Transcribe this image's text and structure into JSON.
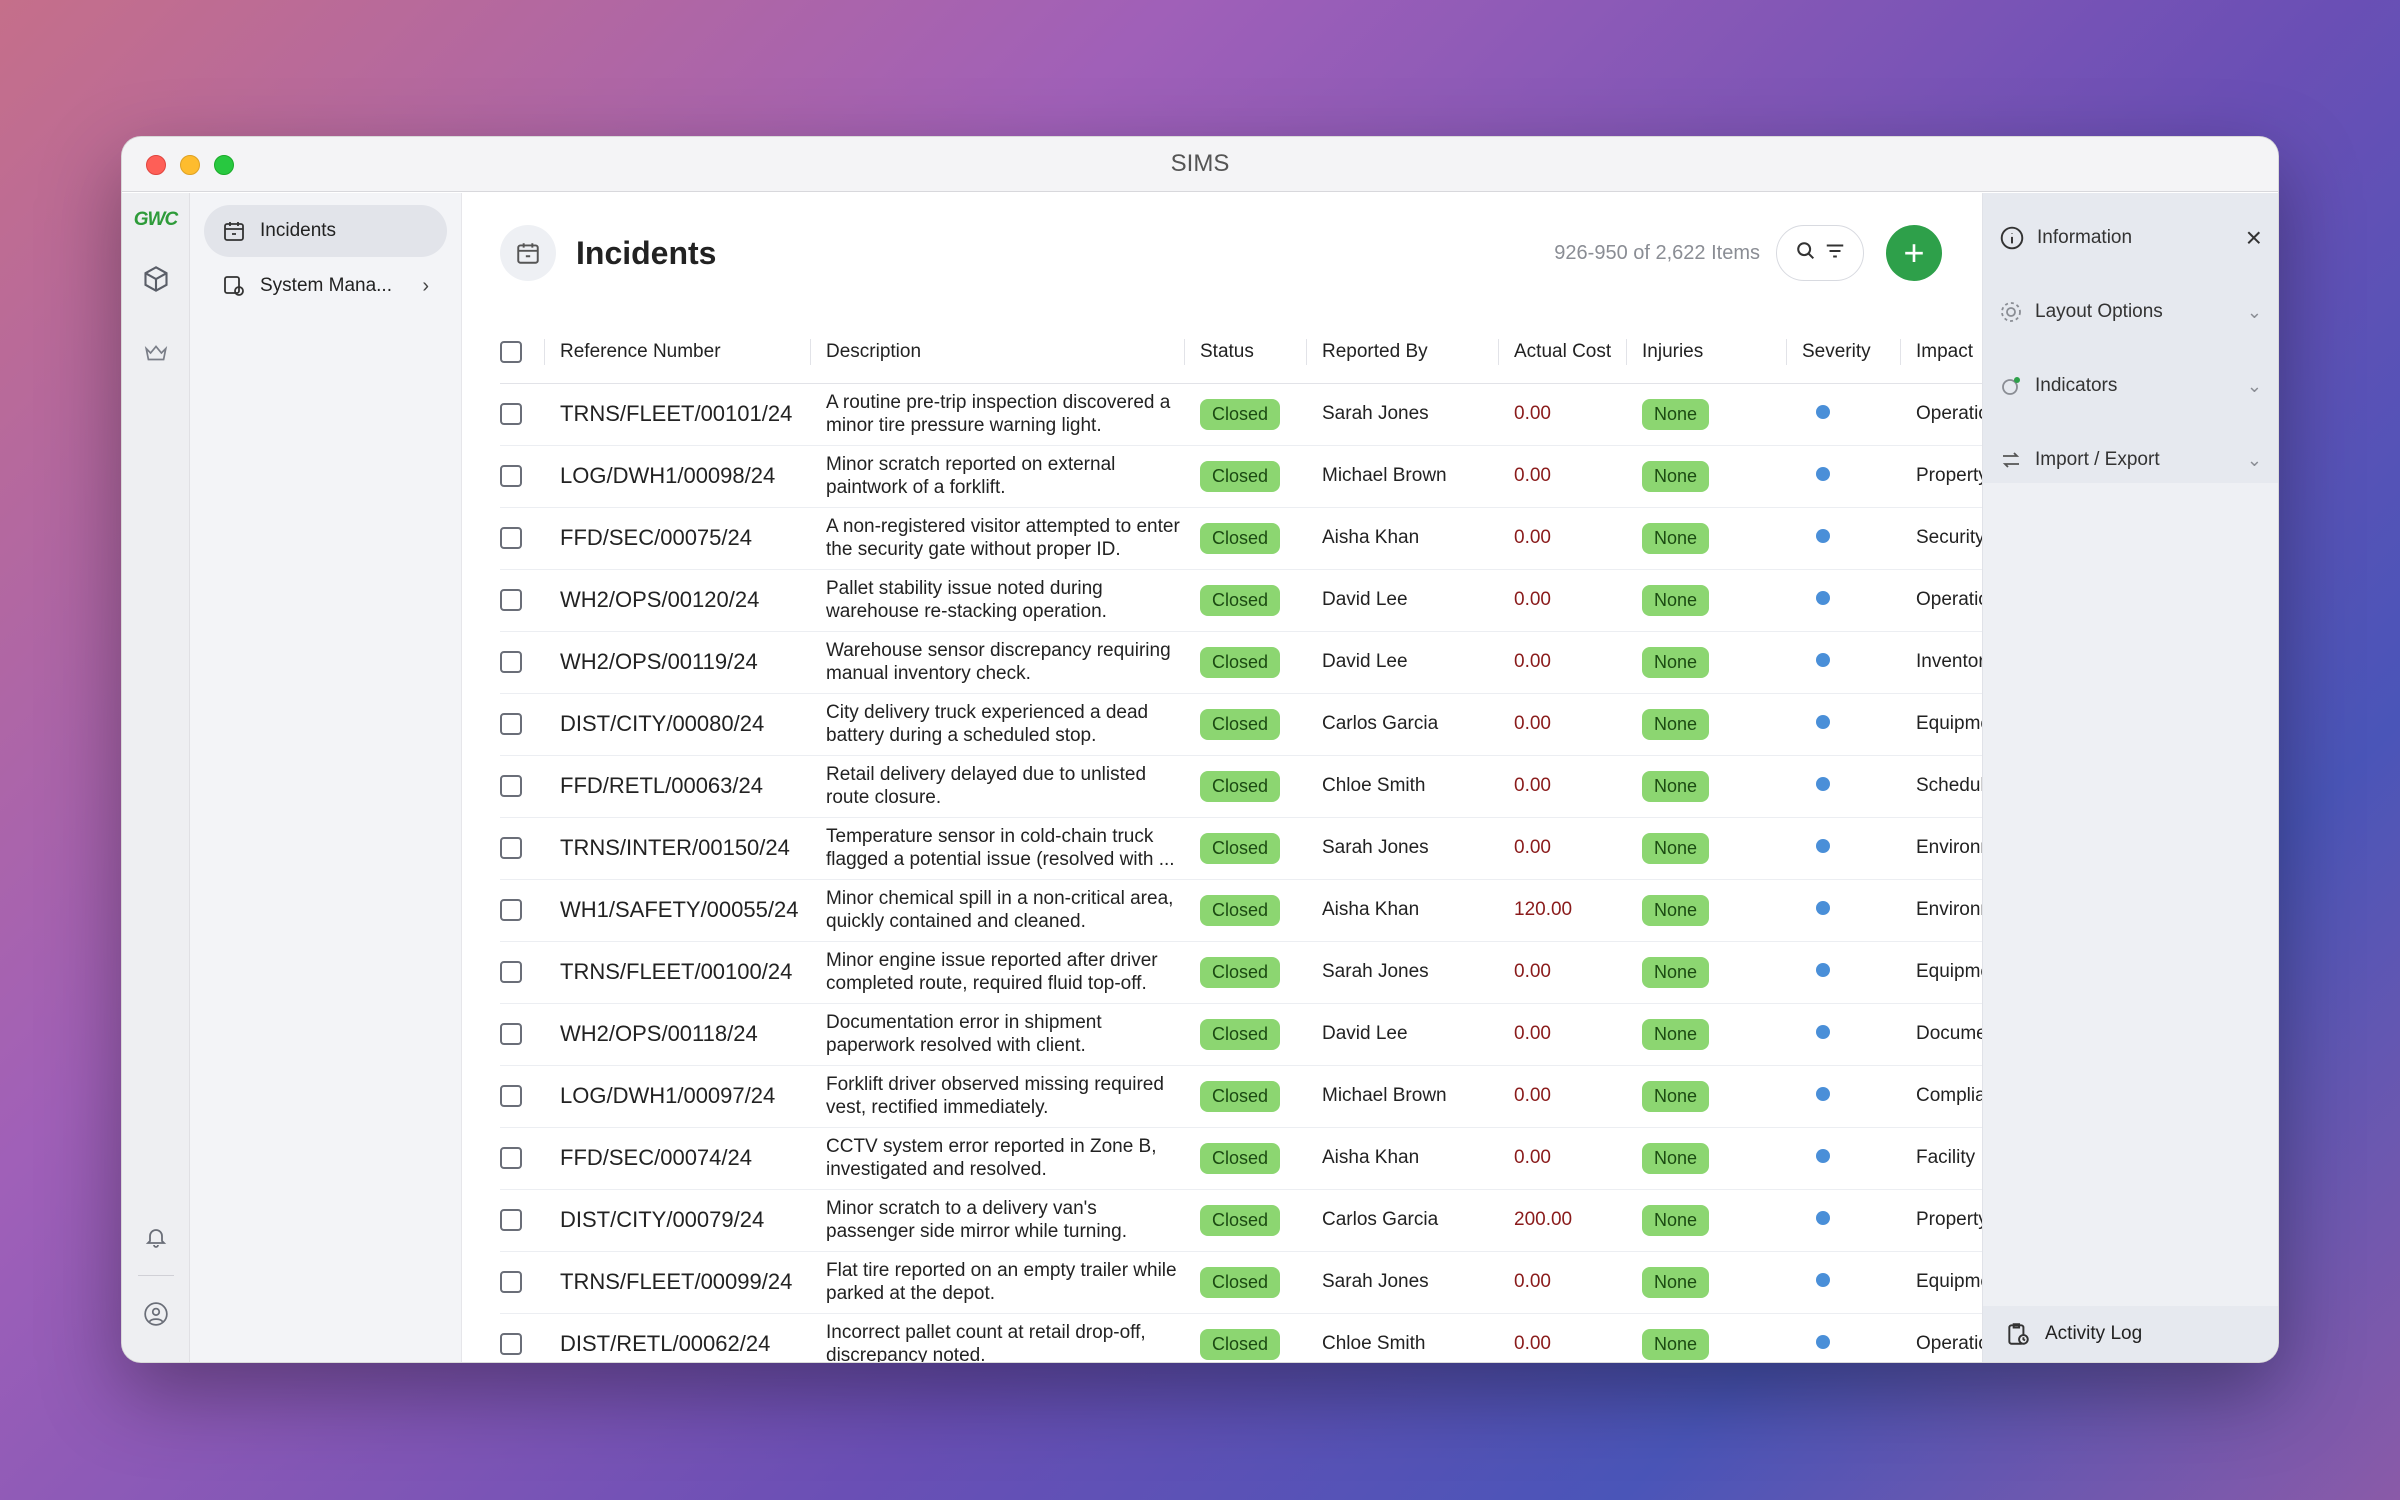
{
  "window": {
    "title": "SIMS"
  },
  "rail": {
    "logo": "GWC"
  },
  "nav": [
    {
      "label": "Incidents",
      "active": true
    },
    {
      "label": "System Mana...",
      "active": false
    }
  ],
  "header": {
    "title": "Incidents",
    "count": "926-950 of 2,622 Items"
  },
  "table": {
    "columns": [
      "Reference Number",
      "Description",
      "Status",
      "Reported By",
      "Actual Cost",
      "Injuries",
      "Severity",
      "Impact"
    ],
    "rows": [
      {
        "ref": "TRNS/FLEET/00101/24",
        "desc": "A routine pre-trip inspection discovered a minor tire pressure warning light.",
        "status": "Closed",
        "by": "Sarah Jones",
        "cost": "0.00",
        "injuries": "None",
        "impact": "Operatio"
      },
      {
        "ref": "LOG/DWH1/00098/24",
        "desc": "Minor scratch reported on external paintwork of a forklift.",
        "status": "Closed",
        "by": "Michael Brown",
        "cost": "0.00",
        "injuries": "None",
        "impact": "Property"
      },
      {
        "ref": "FFD/SEC/00075/24",
        "desc": "A non-registered visitor attempted to enter the security gate without proper ID.",
        "status": "Closed",
        "by": "Aisha Khan",
        "cost": "0.00",
        "injuries": "None",
        "impact": "Security"
      },
      {
        "ref": "WH2/OPS/00120/24",
        "desc": "Pallet stability issue noted during warehouse re-stacking operation.",
        "status": "Closed",
        "by": "David Lee",
        "cost": "0.00",
        "injuries": "None",
        "impact": "Operatio"
      },
      {
        "ref": "WH2/OPS/00119/24",
        "desc": "Warehouse sensor discrepancy requiring manual inventory check.",
        "status": "Closed",
        "by": "David Lee",
        "cost": "0.00",
        "injuries": "None",
        "impact": "Inventory"
      },
      {
        "ref": "DIST/CITY/00080/24",
        "desc": "City delivery truck experienced a dead battery during a scheduled stop.",
        "status": "Closed",
        "by": "Carlos Garcia",
        "cost": "0.00",
        "injuries": "None",
        "impact": "Equipme"
      },
      {
        "ref": "FFD/RETL/00063/24",
        "desc": "Retail delivery delayed due to unlisted route closure.",
        "status": "Closed",
        "by": "Chloe Smith",
        "cost": "0.00",
        "injuries": "None",
        "impact": "Schedul"
      },
      {
        "ref": "TRNS/INTER/00150/24",
        "desc": "Temperature sensor in cold-chain truck flagged a potential issue (resolved with ...",
        "status": "Closed",
        "by": "Sarah Jones",
        "cost": "0.00",
        "injuries": "None",
        "impact": "Environn"
      },
      {
        "ref": "WH1/SAFETY/00055/24",
        "desc": "Minor chemical spill in a non-critical area, quickly contained and cleaned.",
        "status": "Closed",
        "by": "Aisha Khan",
        "cost": "120.00",
        "injuries": "None",
        "impact": "Environn"
      },
      {
        "ref": "TRNS/FLEET/00100/24",
        "desc": "Minor engine issue reported after driver completed route, required fluid top-off.",
        "status": "Closed",
        "by": "Sarah Jones",
        "cost": "0.00",
        "injuries": "None",
        "impact": "Equipme"
      },
      {
        "ref": "WH2/OPS/00118/24",
        "desc": "Documentation error in shipment paperwork resolved with client.",
        "status": "Closed",
        "by": "David Lee",
        "cost": "0.00",
        "injuries": "None",
        "impact": "Docume"
      },
      {
        "ref": "LOG/DWH1/00097/24",
        "desc": "Forklift driver observed missing required vest, rectified immediately.",
        "status": "Closed",
        "by": "Michael Brown",
        "cost": "0.00",
        "injuries": "None",
        "impact": "Complia"
      },
      {
        "ref": "FFD/SEC/00074/24",
        "desc": "CCTV system error reported in Zone B, investigated and resolved.",
        "status": "Closed",
        "by": "Aisha Khan",
        "cost": "0.00",
        "injuries": "None",
        "impact": "Facility"
      },
      {
        "ref": "DIST/CITY/00079/24",
        "desc": "Minor scratch to a delivery van's passenger side mirror while turning.",
        "status": "Closed",
        "by": "Carlos Garcia",
        "cost": "200.00",
        "injuries": "None",
        "impact": "Property"
      },
      {
        "ref": "TRNS/FLEET/00099/24",
        "desc": "Flat tire reported on an empty trailer while parked at the depot.",
        "status": "Closed",
        "by": "Sarah Jones",
        "cost": "0.00",
        "injuries": "None",
        "impact": "Equipme"
      },
      {
        "ref": "DIST/RETL/00062/24",
        "desc": "Incorrect pallet count at retail drop-off, discrepancy noted.",
        "status": "Closed",
        "by": "Chloe Smith",
        "cost": "0.00",
        "injuries": "None",
        "impact": "Operatio"
      }
    ]
  },
  "panel": {
    "information": "Information",
    "layout_options": "Layout Options",
    "indicators": "Indicators",
    "import_export": "Import / Export",
    "activity_log": "Activity Log"
  },
  "colors": {
    "accent": "#2ea04a",
    "badge": "#8cd671",
    "severity": "#4a8fd8"
  }
}
